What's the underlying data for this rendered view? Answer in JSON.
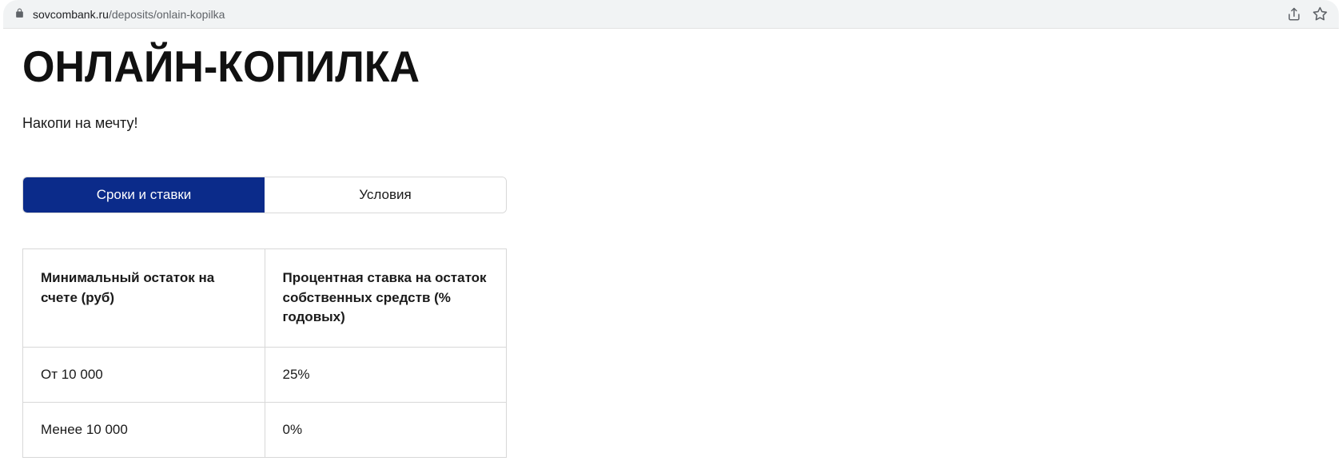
{
  "browser": {
    "url_domain": "sovcombank.ru",
    "url_path": "/deposits/onlain-kopilka"
  },
  "page": {
    "title": "ОНЛАЙН-КОПИЛКА",
    "subtitle": "Накопи на мечту!"
  },
  "tabs": {
    "active": "Сроки и ставки",
    "inactive": "Условия"
  },
  "table": {
    "headers": {
      "col_a": "Минимальный остаток на счете (руб)",
      "col_b": "Процентная ставка на остаток собственных средств (% годовых)"
    },
    "rows": [
      {
        "a": "От 10 000",
        "b": "25%"
      },
      {
        "a": "Менее 10 000",
        "b": "0%"
      }
    ]
  }
}
